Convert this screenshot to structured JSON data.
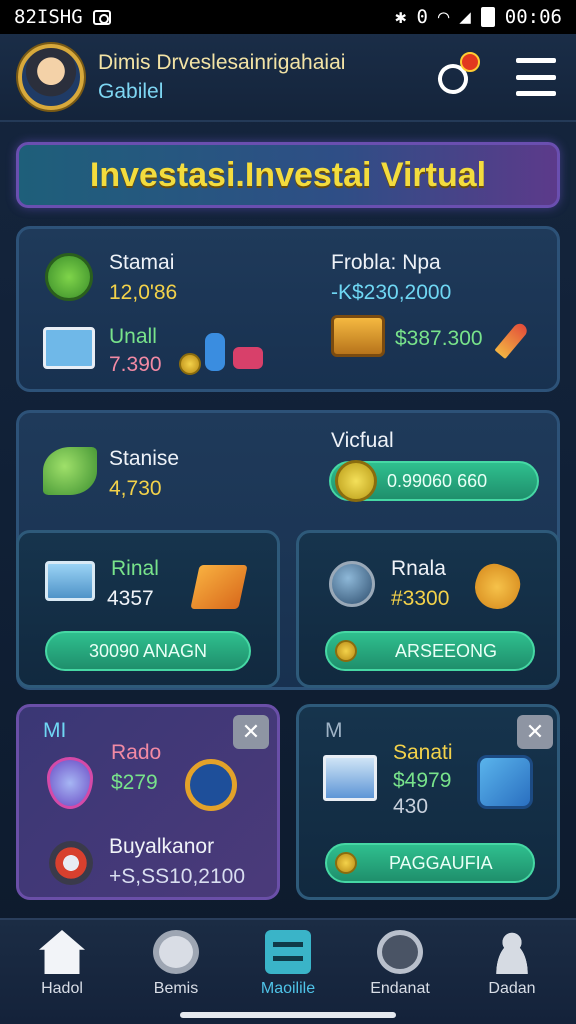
{
  "status_bar": {
    "time_left": "82ISHG",
    "time_right": "00:06",
    "bt": "✱",
    "vibe": "0"
  },
  "header": {
    "name": "Dimis Drveslesainrigahaiai",
    "subtitle": "Gabilel"
  },
  "banner": {
    "title": "Investasi.Investai Virtual"
  },
  "card1": {
    "left_label": "Stamai",
    "left_value": "12,0'86",
    "left2_label": "Unall",
    "left2_value": "7.390",
    "right_label": "Frobla: Npa",
    "right_value": "-K$230,2000",
    "right2_value": "$387.300"
  },
  "card2": {
    "left_label": "Stanise",
    "left_value": "4,730",
    "right_label": "Vicfual",
    "pill_value": "0.99060 660"
  },
  "card3": {
    "label": "Rinal",
    "value": "4357",
    "button": "30090 ANAGN"
  },
  "card4": {
    "label": "Rnala",
    "value": "#3300",
    "button": "ARSEEONG"
  },
  "card5": {
    "tag": "MI",
    "label": "Rado",
    "value": "$279",
    "label2": "Buyalkanor",
    "value2": "+S,SS10,2100",
    "close": "✕"
  },
  "card6": {
    "tag": "M",
    "label": "Sanati",
    "value": "$4979",
    "value2": "430",
    "button": "PAGGAUFIA",
    "close": "✕"
  },
  "nav": {
    "items": [
      {
        "label": "Hadol"
      },
      {
        "label": "Bemis"
      },
      {
        "label": "Maoilile"
      },
      {
        "label": "Endanat"
      },
      {
        "label": "Dadan"
      }
    ]
  },
  "colors": {
    "accent": "#2fbf8e",
    "banner_text": "#f3dc3e",
    "active_nav": "#4fc4e8"
  }
}
